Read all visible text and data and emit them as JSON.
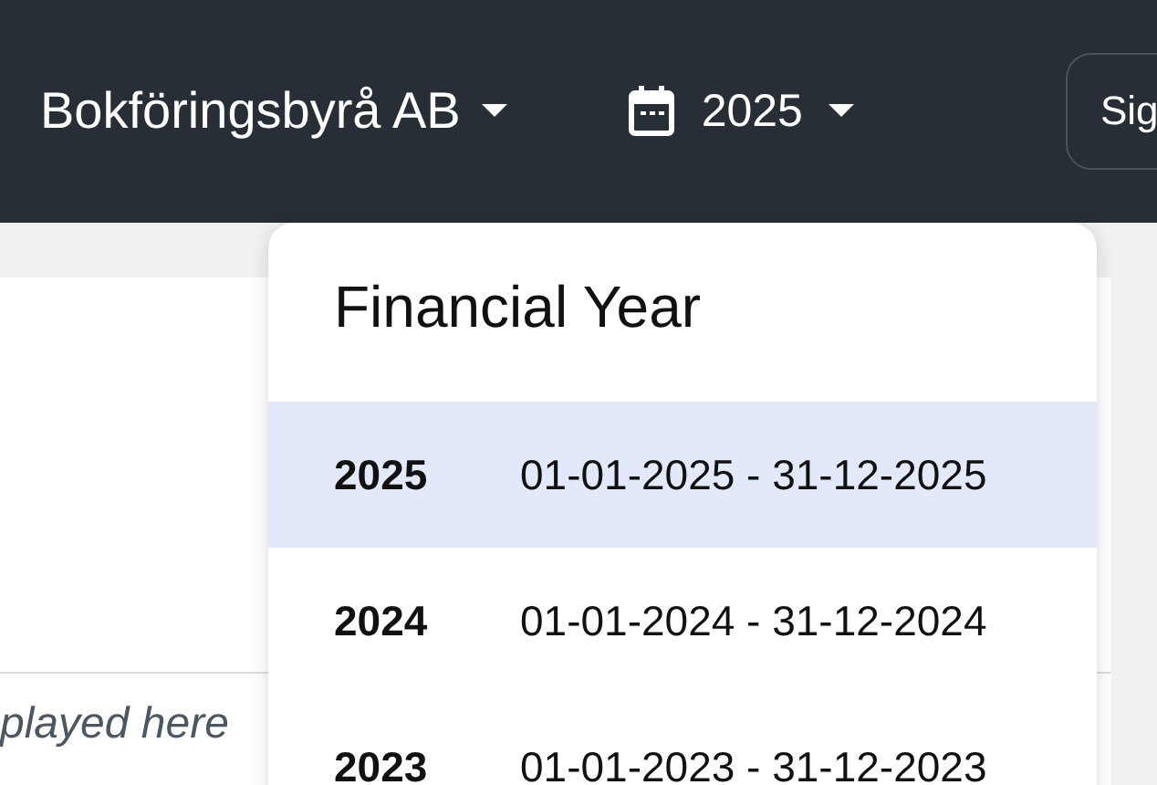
{
  "header": {
    "company": "Bokföringsbyrå AB",
    "year": "2025",
    "button": "Sig"
  },
  "content": {
    "hint": "played here"
  },
  "dropdown": {
    "title": "Financial Year",
    "items": [
      {
        "year": "2025",
        "range": "01-01-2025 - 31-12-2025",
        "selected": true
      },
      {
        "year": "2024",
        "range": "01-01-2024 - 31-12-2024",
        "selected": false
      },
      {
        "year": "2023",
        "range": "01-01-2023 - 31-12-2023",
        "selected": false
      }
    ]
  }
}
